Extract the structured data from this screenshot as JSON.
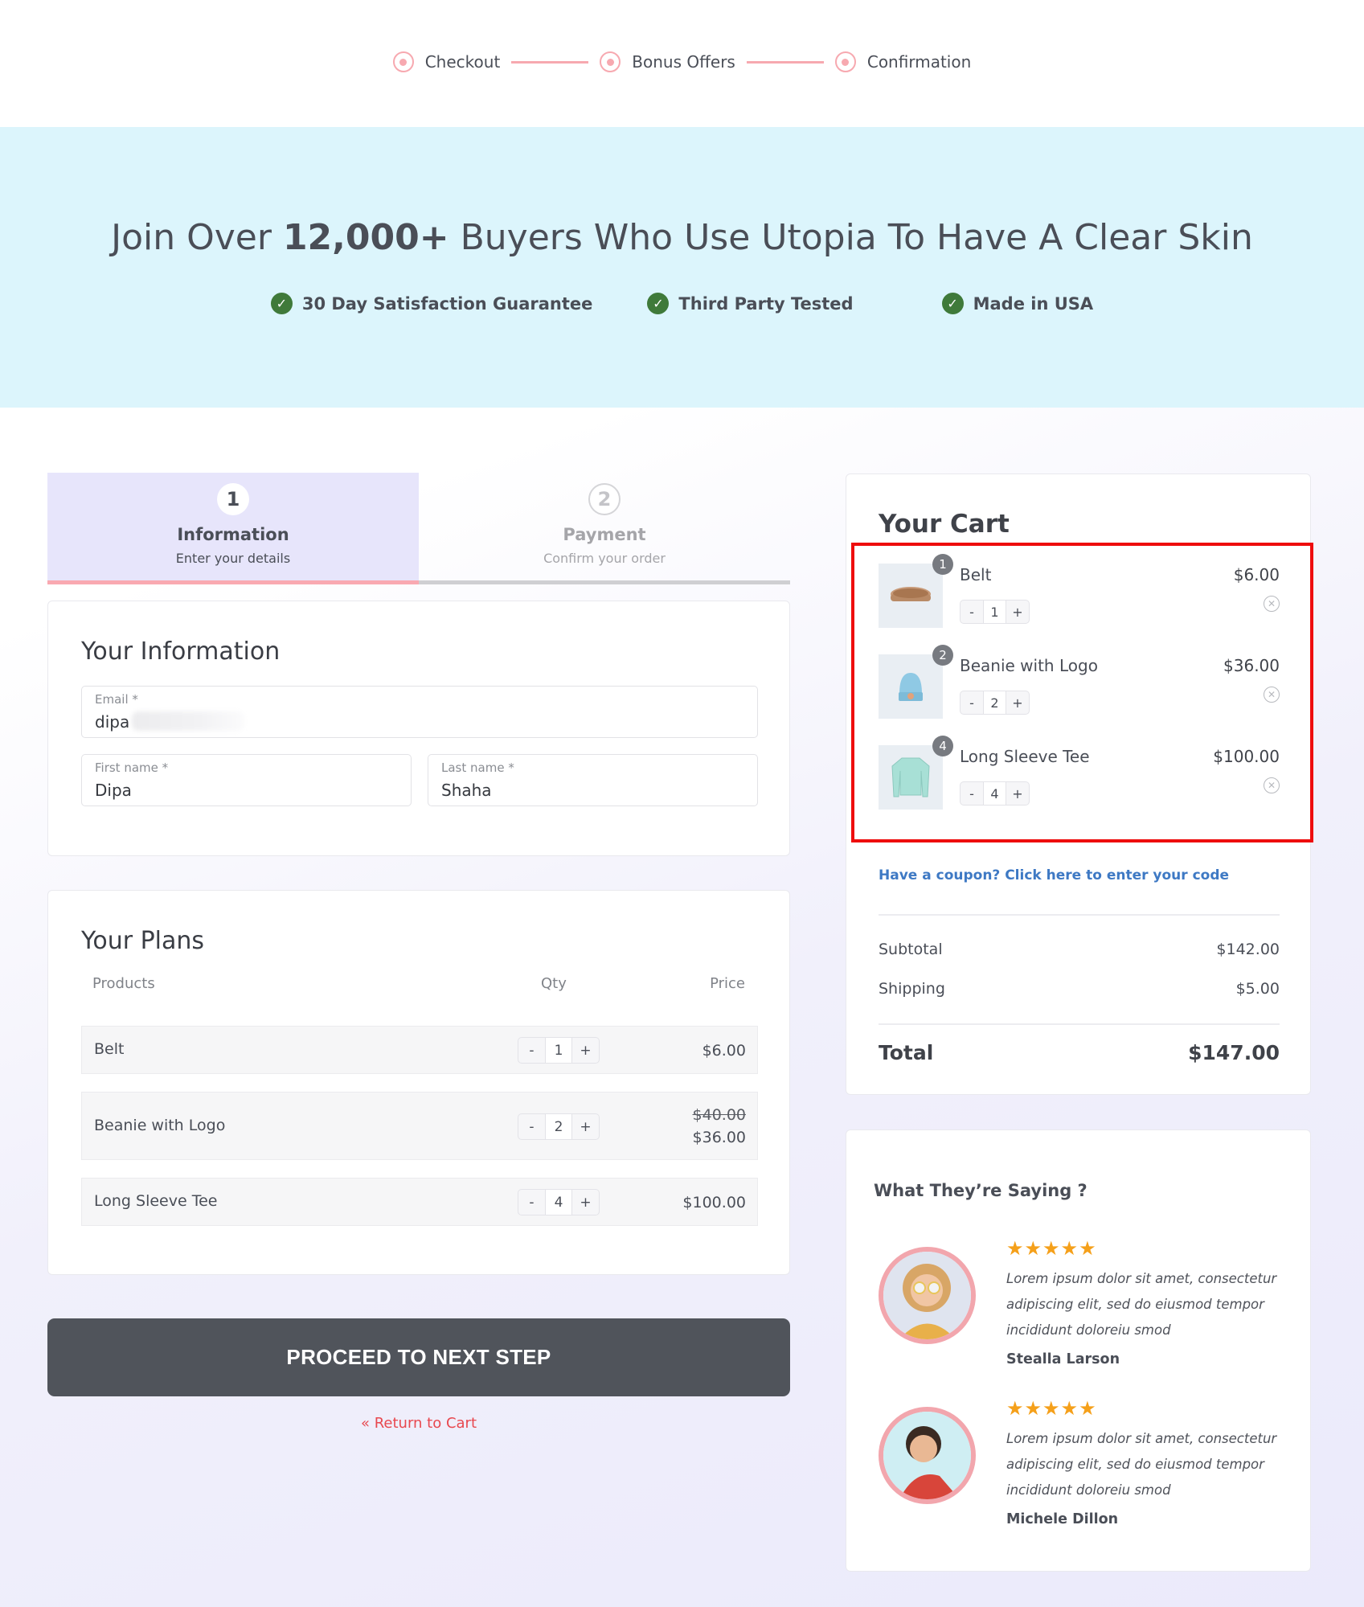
{
  "progress_steps": [
    {
      "label": "Checkout",
      "icon": "radio-dot-icon"
    },
    {
      "label": "Bonus Offers",
      "icon": "radio-dot-icon"
    },
    {
      "label": "Confirmation",
      "icon": "radio-dot-icon"
    }
  ],
  "hero": {
    "headline_pre": "Join Over ",
    "headline_bold": "12,000+",
    "headline_post": " Buyers Who Use Utopia To Have A Clear Skin",
    "background": "#dcf5fc",
    "badges": [
      {
        "label": "30 Day Satisfaction Guarantee",
        "icon": "check-circle-icon"
      },
      {
        "label": "Third Party Tested",
        "icon": "check-circle-icon"
      },
      {
        "label": "Made in USA",
        "icon": "check-circle-icon"
      }
    ]
  },
  "checkout_tabs": [
    {
      "number": "1",
      "title": "Information",
      "subtitle": "Enter your details",
      "active": true
    },
    {
      "number": "2",
      "title": "Payment",
      "subtitle": "Confirm your order",
      "active": false
    }
  ],
  "info_form": {
    "title": "Your Information",
    "email": {
      "label": "Email *",
      "value": "dipa"
    },
    "first_name": {
      "label": "First name *",
      "value": "Dipa"
    },
    "last_name": {
      "label": "Last name *",
      "value": "Shaha"
    }
  },
  "plans": {
    "title": "Your Plans",
    "columns": [
      "Products",
      "Qty",
      "Price"
    ],
    "rows": [
      {
        "product": "Belt",
        "qty": "1",
        "price": "$6.00",
        "original_price": null
      },
      {
        "product": "Beanie with Logo",
        "qty": "2",
        "price": "$36.00",
        "original_price": "$40.00"
      },
      {
        "product": "Long Sleeve Tee",
        "qty": "4",
        "price": "$100.00",
        "original_price": null
      }
    ],
    "minus_label": "-",
    "plus_label": "+"
  },
  "actions": {
    "proceed_label": "PROCEED TO NEXT STEP",
    "return_label": "« Return to Cart"
  },
  "cart": {
    "title": "Your Cart",
    "items": [
      {
        "name": "Belt",
        "qty": "1",
        "badge": "1",
        "price": "$6.00",
        "image": "belt-image"
      },
      {
        "name": "Beanie with Logo",
        "qty": "2",
        "badge": "2",
        "price": "$36.00",
        "image": "beanie-image"
      },
      {
        "name": "Long Sleeve Tee",
        "qty": "4",
        "badge": "4",
        "price": "$100.00",
        "image": "long-sleeve-tee-image"
      }
    ],
    "coupon_link": "Have a coupon? Click here to enter your code",
    "subtotal_label": "Subtotal",
    "subtotal_value": "$142.00",
    "shipping_label": "Shipping",
    "shipping_value": "$5.00",
    "total_label": "Total",
    "total_value": "$147.00",
    "highlight_color": "#ee0d0d"
  },
  "testimonials": {
    "title": "What They’re Saying ?",
    "reviews": [
      {
        "stars": "★★★★★",
        "rating": 5,
        "text": "Lorem ipsum dolor sit amet, consectetur adipiscing elit, sed do eiusmod tempor incididunt doloreiu smod",
        "name": "Stealla Larson"
      },
      {
        "stars": "★★★★★",
        "rating": 5,
        "text": "Lorem ipsum dolor sit amet, consectetur adipiscing elit, sed do eiusmod tempor incididunt doloreiu smod",
        "name": "Michele Dillon"
      }
    ]
  },
  "colors": {
    "accent_pink": "#f7a9b0",
    "button_dark": "#50545b",
    "link_blue": "#3e79c4",
    "link_red": "#e8484f",
    "star_orange": "#f5a01a",
    "check_green": "#3f7a3a"
  }
}
